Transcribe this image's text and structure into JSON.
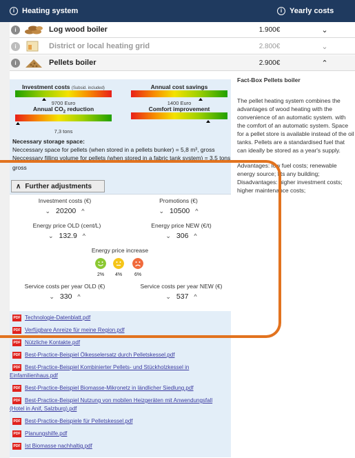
{
  "header": {
    "left_title": "Heating system",
    "right_title": "Yearly costs"
  },
  "rows": [
    {
      "name": "Log wood boiler",
      "cost": "1.900€",
      "chevron": "⌄",
      "state": "normal"
    },
    {
      "name": "District or local heating grid",
      "cost": "2.800€",
      "chevron": "⌄",
      "state": "grey"
    },
    {
      "name": "Pellets boiler",
      "cost": "2.900€",
      "chevron": "⌃",
      "state": "active"
    }
  ],
  "indicators": {
    "investment": {
      "title": "Investment costs",
      "note": "(Subsid. included)",
      "value": "9700 Euro",
      "level": 0.3
    },
    "savings": {
      "title": "Annual cost savings",
      "value": "1400 Euro",
      "level": 0.72
    },
    "co2": {
      "title": "Annual CO",
      "title_sub": "2",
      "title_end": " reduction",
      "value": "7,3 tons",
      "level": 0.03
    },
    "comfort": {
      "title": "Comfort improvement",
      "value": "",
      "level": 0.8
    }
  },
  "storage": {
    "heading": "Necessary storage space:",
    "line1": "Neccessary space for pellets (when stored in a pellets bunker) = 5,8 m³, gross",
    "line2": "Neccessary filling volume for pellets (when stored in a fabric tank system) = 3,5 tons",
    "line3": "gross"
  },
  "adjustments": {
    "button_label": "Further adjustments",
    "investment_label": "Investment costs (€)",
    "investment_value": "20200",
    "promotions_label": "Promotions (€)",
    "promotions_value": "10500",
    "price_old_label": "Energy price OLD (cent/L)",
    "price_old_value": "132.9",
    "price_new_label": "Energy price NEW (€/t)",
    "price_new_value": "306",
    "increase_label": "Energy price increase",
    "increase_options": [
      "2%",
      "4%",
      "6%"
    ],
    "service_old_label": "Service costs per year OLD (€)",
    "service_old_value": "330",
    "service_new_label": "Service costs per year NEW (€)",
    "service_new_value": "537"
  },
  "links": [
    "Technologie-Datenblatt.pdf",
    "Verfügbare Anreize für meine Region.pdf",
    "Nützliche Kontakte.pdf",
    "Best-Practice-Beispiel Ölkesselersatz durch Pelletskessel.pdf",
    "Best-Practice-Beispiel Kombinierter Pellets- und Stückholzkessel in",
    "Einfamilienhaus.pdf",
    "Best-Practice-Beispiel Biomasse-Mikronetz in ländlicher Siedlung.pdf",
    "Best-Practice-Beispiel Nutzung von mobilen Heizgeräten mit Anwendungsfall",
    "(Hotel in Anif, Salzburg).pdf",
    "Best-Practice-Beispiele für Pelletskessel.pdf",
    "Planungshilfe.pdf",
    "Ist Biomasse nachhaltig.pdf"
  ],
  "pdf_badge": "PDF",
  "factbox": {
    "title": "Fact-Box Pellets boiler",
    "para1": "The pellet heating system combines the advantages of wood heating with the convenience of an automatic system. with the comfort of an automatic system. Space for a pellet store is available instead of the oil tanks. Pellets are a standardised fuel that can ideally be stored as a year's supply.",
    "para2": "Advantages: low fuel costs; renewable energy source; fits any building; Disadvantages: higher investment costs; higher maintenance costs;"
  },
  "icons": {
    "info": "info-icon",
    "chevron_down": "chevron-down-icon",
    "chevron_up": "chevron-up-icon",
    "pdf": "pdf-icon"
  },
  "colors": {
    "header_bg": "#1f3a5f",
    "panel_bg": "#e3eef8",
    "highlight": "#e2731f",
    "pdf_red": "#e0231f",
    "link": "#3a3aa0"
  }
}
